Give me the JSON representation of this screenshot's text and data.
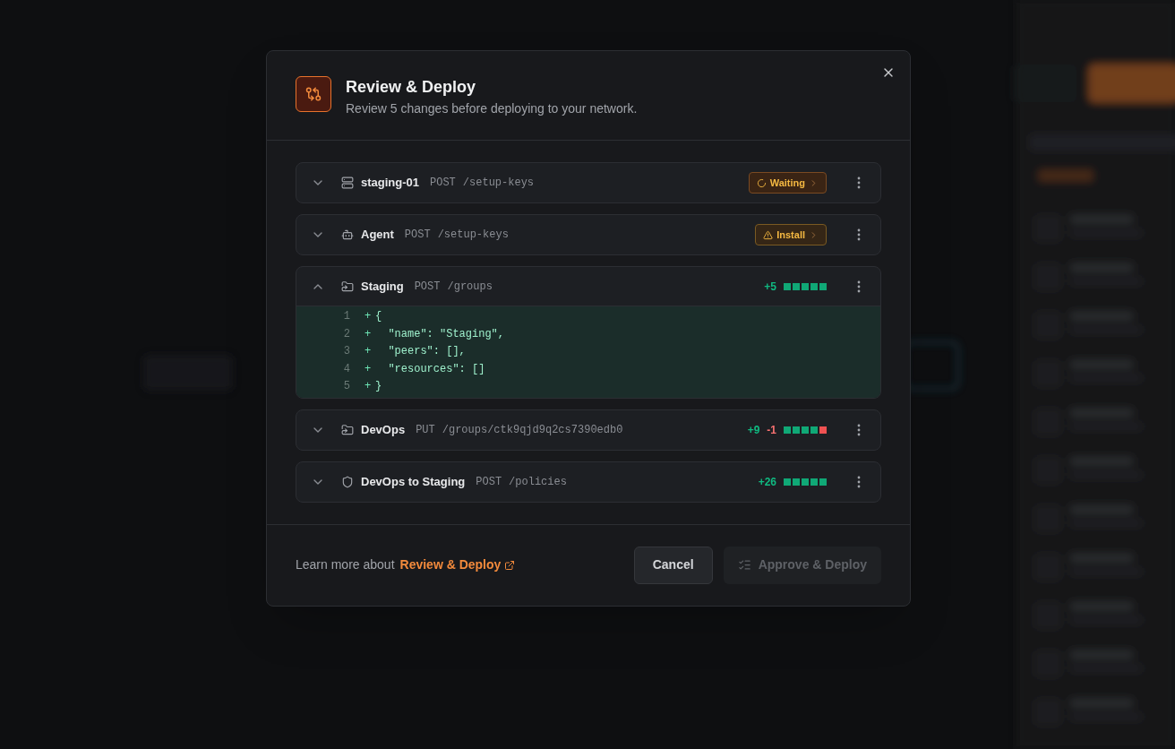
{
  "dialog": {
    "title": "Review & Deploy",
    "subtitle": "Review 5 changes before deploying to your network."
  },
  "changes": [
    {
      "name": "staging-01",
      "kind": "peer",
      "method": "POST",
      "path": "/setup-keys",
      "expanded": false,
      "status": {
        "kind": "waiting",
        "label": "Waiting"
      }
    },
    {
      "name": "Agent",
      "kind": "agent",
      "method": "POST",
      "path": "/setup-keys",
      "expanded": false,
      "status": {
        "kind": "install",
        "label": "Install"
      }
    },
    {
      "name": "Staging",
      "kind": "group",
      "method": "POST",
      "path": "/groups",
      "expanded": true,
      "added": "+5",
      "bar": [
        {
          "kind": "add"
        },
        {
          "kind": "add"
        },
        {
          "kind": "add"
        },
        {
          "kind": "add"
        },
        {
          "kind": "add"
        }
      ],
      "diff": [
        {
          "number": "1",
          "sign": "+",
          "code": "{"
        },
        {
          "number": "2",
          "sign": "+",
          "code": "  \"name\": \"Staging\","
        },
        {
          "number": "3",
          "sign": "+",
          "code": "  \"peers\": [],"
        },
        {
          "number": "4",
          "sign": "+",
          "code": "  \"resources\": []"
        },
        {
          "number": "5",
          "sign": "+",
          "code": "}"
        }
      ]
    },
    {
      "name": "DevOps",
      "kind": "group",
      "method": "PUT",
      "path": "/groups/ctk9qjd9q2cs7390edb0",
      "expanded": false,
      "added": "+9",
      "removed": "-1",
      "bar": [
        {
          "kind": "add"
        },
        {
          "kind": "add"
        },
        {
          "kind": "add"
        },
        {
          "kind": "add"
        },
        {
          "kind": "remove"
        }
      ]
    },
    {
      "name": "DevOps to Staging",
      "kind": "policy",
      "method": "POST",
      "path": "/policies",
      "expanded": false,
      "added": "+26",
      "bar": [
        {
          "kind": "add"
        },
        {
          "kind": "add"
        },
        {
          "kind": "add"
        },
        {
          "kind": "add"
        },
        {
          "kind": "add"
        }
      ]
    }
  ],
  "footer": {
    "text": "Learn more about",
    "link": "Review & Deploy",
    "cancel": "Cancel",
    "approve": {
      "label": "Approve & Deploy",
      "disabled": true
    }
  }
}
